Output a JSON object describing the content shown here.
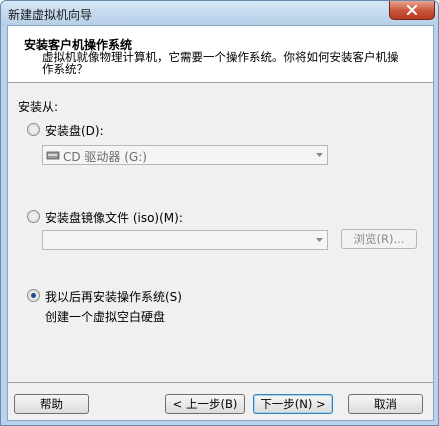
{
  "window": {
    "title": "新建虚拟机向导"
  },
  "header": {
    "title": "安装客户机操作系统",
    "description": "虚拟机就像物理计算机，它需要一个操作系统。你将如何安装客户机操作系统？"
  },
  "install_source": {
    "label": "安装从:",
    "disc": {
      "label": "安装盘(D):",
      "selected": false,
      "drive_value": "CD 驱动器 (G:)"
    },
    "iso": {
      "label": "安装盘镜像文件 (iso)(M):",
      "selected": false,
      "path_value": "",
      "browse_label": "浏览(R)..."
    },
    "later": {
      "label": "我以后再安装操作系统(S)",
      "selected": true,
      "description": "创建一个虚拟空白硬盘"
    }
  },
  "footer": {
    "help_label": "帮助",
    "back_label": "< 上一步(B)",
    "next_label": "下一步(N) >",
    "cancel_label": "取消"
  },
  "colors": {
    "title_bar": "#c4d8ee",
    "close_button": "#c7553a",
    "selected_radio": "#1f4e8c",
    "default_button_border": "#3c7fb1"
  }
}
